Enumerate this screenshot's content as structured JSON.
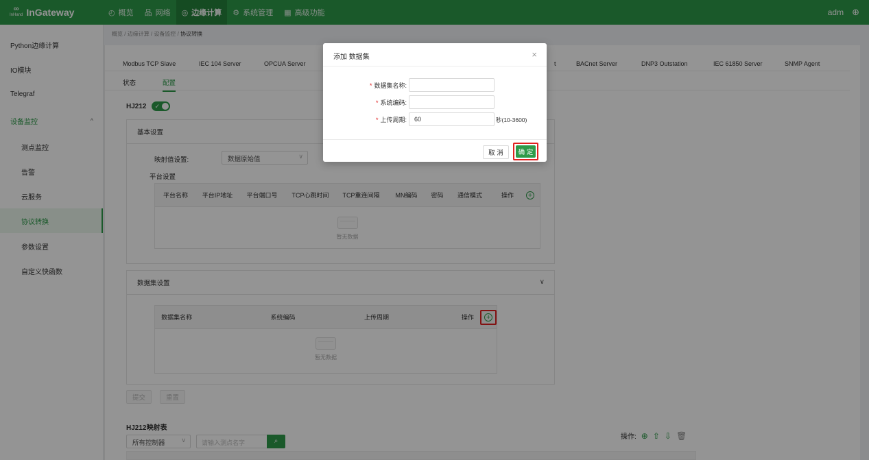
{
  "app": {
    "brand_mark": "InHand",
    "name": "InGateway",
    "user": "adm",
    "globe_icon": "globe-icon"
  },
  "nav": {
    "items": [
      {
        "icon": "◴",
        "label": "概览"
      },
      {
        "icon": "品",
        "label": "网络"
      },
      {
        "icon": "◎",
        "label": "边缘计算"
      },
      {
        "icon": "⚙",
        "label": "系统管理"
      },
      {
        "icon": "▦",
        "label": "高级功能"
      }
    ]
  },
  "sidebar": {
    "items": [
      {
        "label": "Python边缘计算"
      },
      {
        "label": "IO模块"
      },
      {
        "label": "Telegraf"
      },
      {
        "label": "设备监控"
      },
      {
        "label": "测点监控"
      },
      {
        "label": "告警"
      },
      {
        "label": "云服务"
      },
      {
        "label": "协议转换"
      },
      {
        "label": "参数设置"
      },
      {
        "label": "自定义快函数"
      }
    ]
  },
  "breadcrumb": {
    "p1": "概览",
    "p2": "边缘计算",
    "p3": "设备监控",
    "p4": "协议转换",
    "sep": "/"
  },
  "protocol_tabs": [
    "Modbus TCP Slave",
    "IEC 104 Server",
    "OPCUA Server",
    "t",
    "BACnet Server",
    "DNP3 Outstation",
    "IEC 61850 Server",
    "SNMP Agent"
  ],
  "sub_tabs": {
    "status": "状态",
    "config": "配置"
  },
  "hj212": {
    "label": "HJ212",
    "switch_check": "✓"
  },
  "basic": {
    "title": "基本设置",
    "mapping_label": "映射值设置:",
    "mapping_value": "数据原始值",
    "platform_label": "平台设置",
    "columns": [
      "平台名称",
      "平台IP地址",
      "平台端口号",
      "TCP心跳时间",
      "TCP重连间隔",
      "MN编码",
      "密码",
      "通信模式",
      "操作"
    ],
    "empty": "暂无数据"
  },
  "dataset": {
    "title": "数据集设置",
    "columns": [
      "数据集名称",
      "系统编码",
      "上传周期",
      "操作"
    ],
    "empty": "暂无数据"
  },
  "actions": {
    "submit": "提交",
    "reset": "重置"
  },
  "mapping_table": {
    "title": "HJ212映射表",
    "controller_select": "所有控制器",
    "search_placeholder": "请输入测点名字",
    "ops_label": "操作:"
  },
  "modal": {
    "title": "添加 数据集",
    "close": "×",
    "fields": {
      "name_label": "数据集名称:",
      "code_label": "系统编码:",
      "period_label": "上传周期:",
      "period_value": "60",
      "period_suffix": "秒(10-3600)",
      "required_mark": "*"
    },
    "cancel": "取 消",
    "confirm": "确 定"
  },
  "colors": {
    "brand_green": "#2e9a49",
    "highlight_red": "#e02020"
  }
}
